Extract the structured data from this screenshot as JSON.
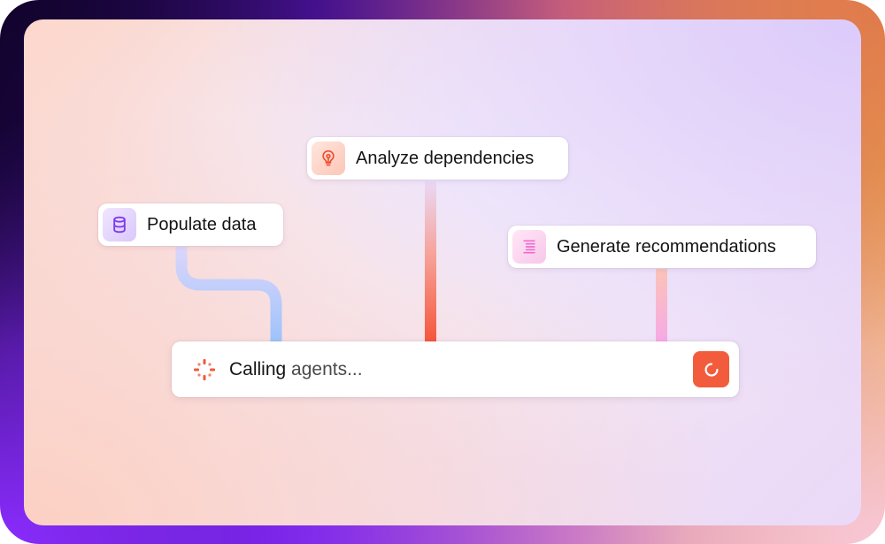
{
  "colors": {
    "accent": "#F25C3D",
    "populate_line": "#A9C8FA",
    "analyze_line": "#F6573E",
    "generate_line": "#F7A9E2"
  },
  "tasks": [
    {
      "label": "Populate data",
      "icon": "database-icon"
    },
    {
      "label": "Analyze dependencies",
      "icon": "lightbulb-icon"
    },
    {
      "label": "Generate recommendations",
      "icon": "text-lines-icon"
    }
  ],
  "status": {
    "icon": "sparkle-icon",
    "text_strong": "Calling",
    "text_rest": " agents...",
    "action_icon": "refresh-spinner-icon"
  }
}
